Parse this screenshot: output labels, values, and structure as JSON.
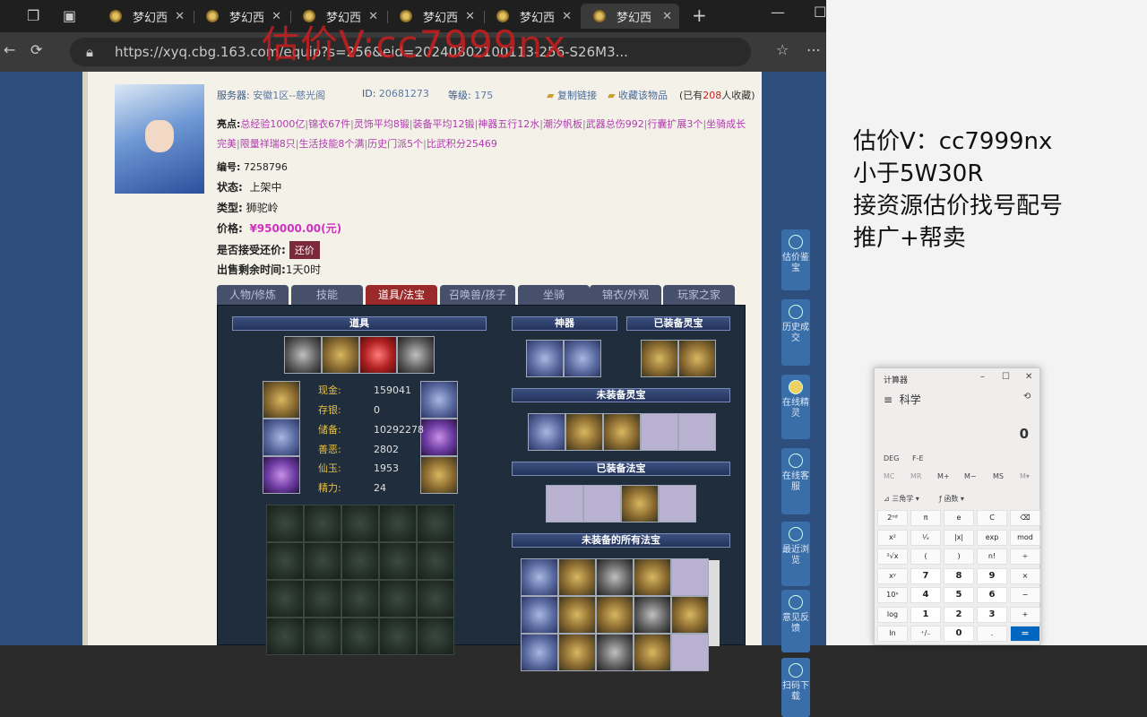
{
  "browser": {
    "tabs": [
      "梦幻西",
      "梦幻西",
      "梦幻西",
      "梦幻西",
      "梦幻西",
      "梦幻西"
    ],
    "url": "https://xyq.cbg.163.com/equip?s=256&eid=20240802100113-256-S26M3..."
  },
  "watermark": "估价V:cc7999nx",
  "role": {
    "server_label": "服务器:",
    "server": "安徽1区--慈光阁",
    "id_label": "ID:",
    "id": "20681273",
    "level_label": "等级:",
    "level": "175",
    "copy_link": "复制链接",
    "favorite": "收藏该物品",
    "fav_count_pre": "(已有",
    "fav_count": "208",
    "fav_count_post": "人收藏)"
  },
  "highlights": {
    "label": "亮点:",
    "items": [
      "总经验1000亿",
      "锦衣67件",
      "灵饰平均8锻",
      "装备平均12锻",
      "神器五行12水",
      "潮汐帆板",
      "武器总伤992",
      "行囊扩展3个",
      "坐骑成长完美",
      "限量祥瑞8只",
      "生活技能8个满",
      "历史门派5个",
      "比武积分25469"
    ]
  },
  "info": {
    "serial_label": "编号:",
    "serial": "7258796",
    "status_label": "状态:",
    "status": "上架中",
    "type_label": "类型:",
    "type": "狮驼岭",
    "price_label": "价格:",
    "price": "¥950000.00(元)",
    "bargain_label": "是否接受还价:",
    "bargain_btn": "还价",
    "time_label": "出售剩余时间:",
    "time": "1天0时"
  },
  "ptabs": [
    "人物/修炼",
    "技能",
    "道具/法宝",
    "召唤兽/孩子",
    "坐骑",
    "锦衣/外观",
    "玩家之家"
  ],
  "sections": {
    "props": "道具",
    "artifact": "神器",
    "equipped_spirit": "已装备灵宝",
    "unequipped_spirit": "未装备灵宝",
    "equipped_fabao": "已装备法宝",
    "all_fabao": "未装备的所有法宝"
  },
  "money": {
    "cash_label": "现金:",
    "cash": "159041",
    "deposit_label": "存银:",
    "deposit": "0",
    "reserve_label": "储备:",
    "reserve": "10292278",
    "karma_label": "善恶:",
    "karma": "2802",
    "jade_label": "仙玉:",
    "jade": "1953",
    "energy_label": "精力:",
    "energy": "24"
  },
  "sidebar": [
    {
      "label": "估价鉴宝",
      "icon": "appraise-icon"
    },
    {
      "label": "历史成交",
      "icon": "history-icon"
    },
    {
      "label": "在线精灵",
      "icon": "sprite-icon"
    },
    {
      "label": "在线客服",
      "icon": "headset-icon"
    },
    {
      "label": "最近浏览",
      "icon": "clock-icon"
    },
    {
      "label": "意见反馈",
      "icon": "feedback-icon"
    },
    {
      "label": "扫码下载",
      "icon": "qr-icon"
    }
  ],
  "promo": [
    "估价V：cc7999nx",
    "小于5W30R",
    "接资源估价找号配号",
    "推广+帮卖"
  ],
  "calculator": {
    "title": "计算器",
    "mode": "科学",
    "display": "0",
    "deg": "DEG",
    "fe": "F-E",
    "mem": [
      "MC",
      "MR",
      "M+",
      "M−",
      "MS",
      "M▾"
    ],
    "trig": "三角学",
    "func": "函数",
    "keys": [
      [
        "2ⁿᵈ",
        "π",
        "e",
        "C",
        "⌫"
      ],
      [
        "x²",
        "¹⁄ₓ",
        "|x|",
        "exp",
        "mod"
      ],
      [
        "²√x",
        "(",
        ")",
        "n!",
        "÷"
      ],
      [
        "xʸ",
        "7",
        "8",
        "9",
        "×"
      ],
      [
        "10ˣ",
        "4",
        "5",
        "6",
        "−"
      ],
      [
        "log",
        "1",
        "2",
        "3",
        "+"
      ],
      [
        "ln",
        "⁺/₋",
        "0",
        ".",
        "="
      ]
    ]
  }
}
